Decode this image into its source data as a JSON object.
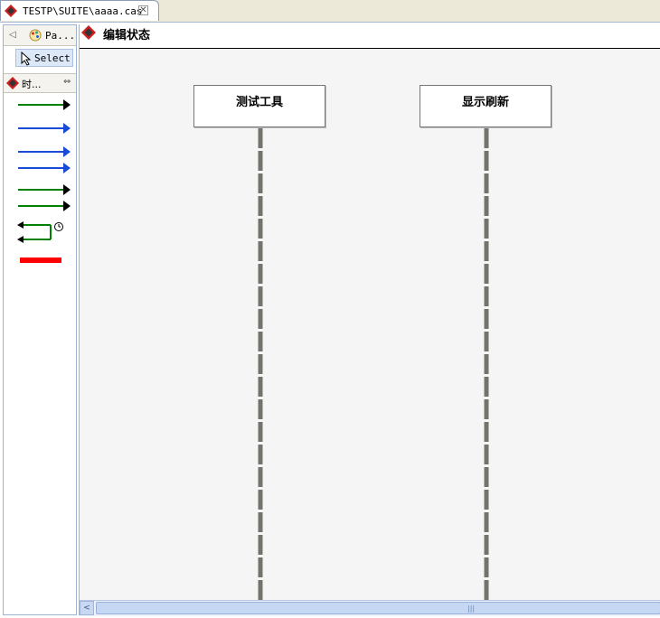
{
  "tab": {
    "title": "TESTP\\SUITE\\aaaa.cas",
    "close": "✕"
  },
  "palette": {
    "back": "◁",
    "title": "Pa...",
    "select_label": "Select",
    "drawer_label": "时...",
    "drawer_collapse": "⇔"
  },
  "editor": {
    "title": "编辑状态",
    "lifelines": [
      {
        "name": "测试工具"
      },
      {
        "name": "显示刷新"
      }
    ]
  },
  "colors": {
    "green_arrow": "#008000",
    "blue_arrow": "#1a4bd6",
    "red_bar": "#ff0000",
    "lifeline": "#73736b",
    "brand_diamond": "#cc1f1f"
  },
  "icons": {
    "tab": "diamond-logo-icon",
    "select": "arrow-cursor-icon",
    "timer": "clock-icon"
  }
}
